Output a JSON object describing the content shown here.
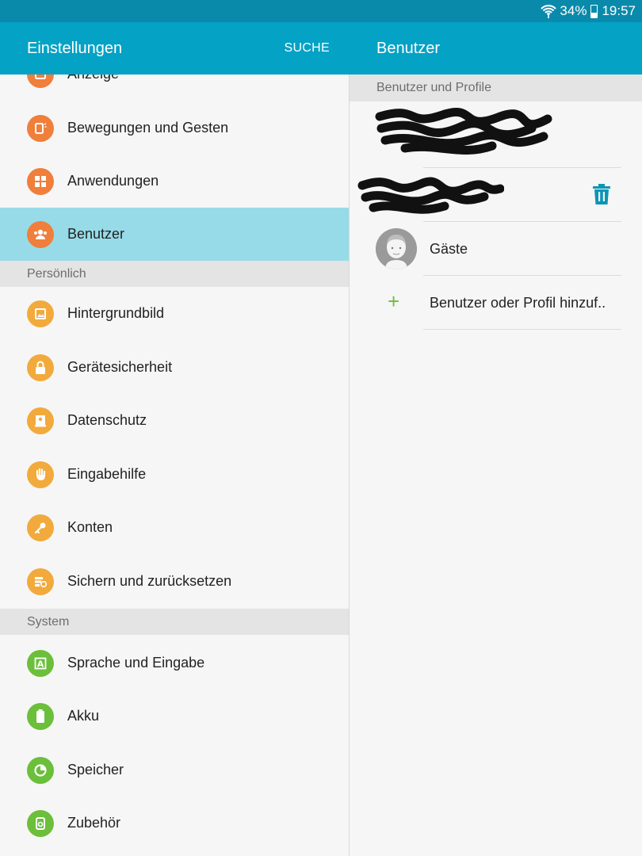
{
  "status_bar": {
    "battery_percent": "34%",
    "time": "19:57"
  },
  "left_header": {
    "title": "Einstellungen",
    "search_label": "SUCHE"
  },
  "right_header": {
    "title": "Benutzer"
  },
  "left_list": {
    "partial_item": {
      "label": "Anzeige"
    },
    "items_top": [
      {
        "label": "Bewegungen und Gesten"
      },
      {
        "label": "Anwendungen"
      },
      {
        "label": "Benutzer"
      }
    ],
    "section_personal": "Persönlich",
    "items_personal": [
      {
        "label": "Hintergrundbild"
      },
      {
        "label": "Gerätesicherheit"
      },
      {
        "label": "Datenschutz"
      },
      {
        "label": "Eingabehilfe"
      },
      {
        "label": "Konten"
      },
      {
        "label": "Sichern und zurücksetzen"
      }
    ],
    "section_system": "System",
    "items_system": [
      {
        "label": "Sprache und Eingabe"
      },
      {
        "label": "Akku"
      },
      {
        "label": "Speicher"
      },
      {
        "label": "Zubehör"
      }
    ]
  },
  "right_list": {
    "section_title": "Benutzer und Profile",
    "guest_label": "Gäste",
    "add_label": "Benutzer oder Profil hinzuf.."
  },
  "colors": {
    "header": "#04a2c5",
    "status_bar": "#0a8aab",
    "selected_row": "#97dbe8",
    "icon_orange": "#ef7f3b",
    "icon_amber": "#f2aa3c",
    "icon_green": "#6bbf3b",
    "trash_icon": "#0a95b6"
  }
}
